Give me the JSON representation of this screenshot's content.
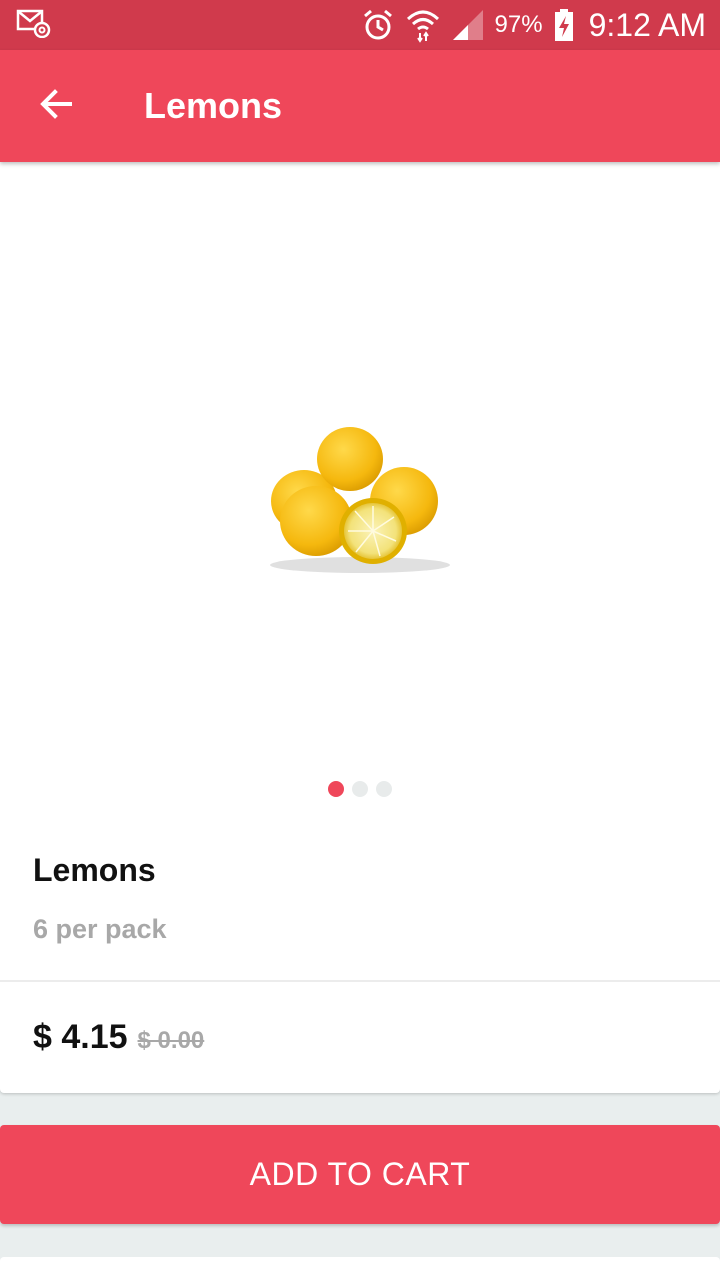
{
  "status_bar": {
    "battery": "97%",
    "time": "9:12 AM",
    "icons": [
      "email-notification-icon",
      "alarm-icon",
      "wifi-icon",
      "signal-icon",
      "battery-charging-icon"
    ]
  },
  "app_bar": {
    "title": "Lemons",
    "back_icon": "arrow-back-icon"
  },
  "product": {
    "image": "lemons-photo",
    "name": "Lemons",
    "pack": "6 per pack",
    "price": "$ 4.15",
    "old_price": "$ 0.00",
    "gallery_pages": 3,
    "gallery_active_page": 1
  },
  "actions": {
    "add_to_cart": "ADD TO CART"
  },
  "colors": {
    "status_bar": "#d03a4c",
    "accent": "#ef475a",
    "background": "#e9eeee",
    "muted_text": "#a8a8a8"
  }
}
